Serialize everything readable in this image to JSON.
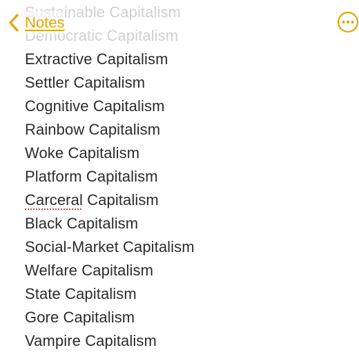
{
  "header": {
    "back_label": "Notes",
    "back_icon": "chevron-left-icon",
    "more_icon": "ellipsis-circle-icon",
    "accent_color": "#e0a800"
  },
  "note": {
    "faded_lines": [
      "Sustainable Capitalism",
      "Democratic Capitalism"
    ],
    "lines": [
      "Extractive Capitalism",
      "Settler Capitalism",
      "Cognitive Capitalism",
      "Rainbow Capitalism",
      "Woke Capitalism",
      "Platform Capitalism",
      "Capitalism",
      "Black Capitalism",
      "Social-Market Capitalism",
      "Welfare Capitalism",
      "State Capitalism",
      "Gore Capitalism",
      "Vampire Capitalism"
    ],
    "misspelled_word": "Carceral",
    "misspelled_line_index": 6,
    "spellcheck_color": "#e0352b"
  }
}
